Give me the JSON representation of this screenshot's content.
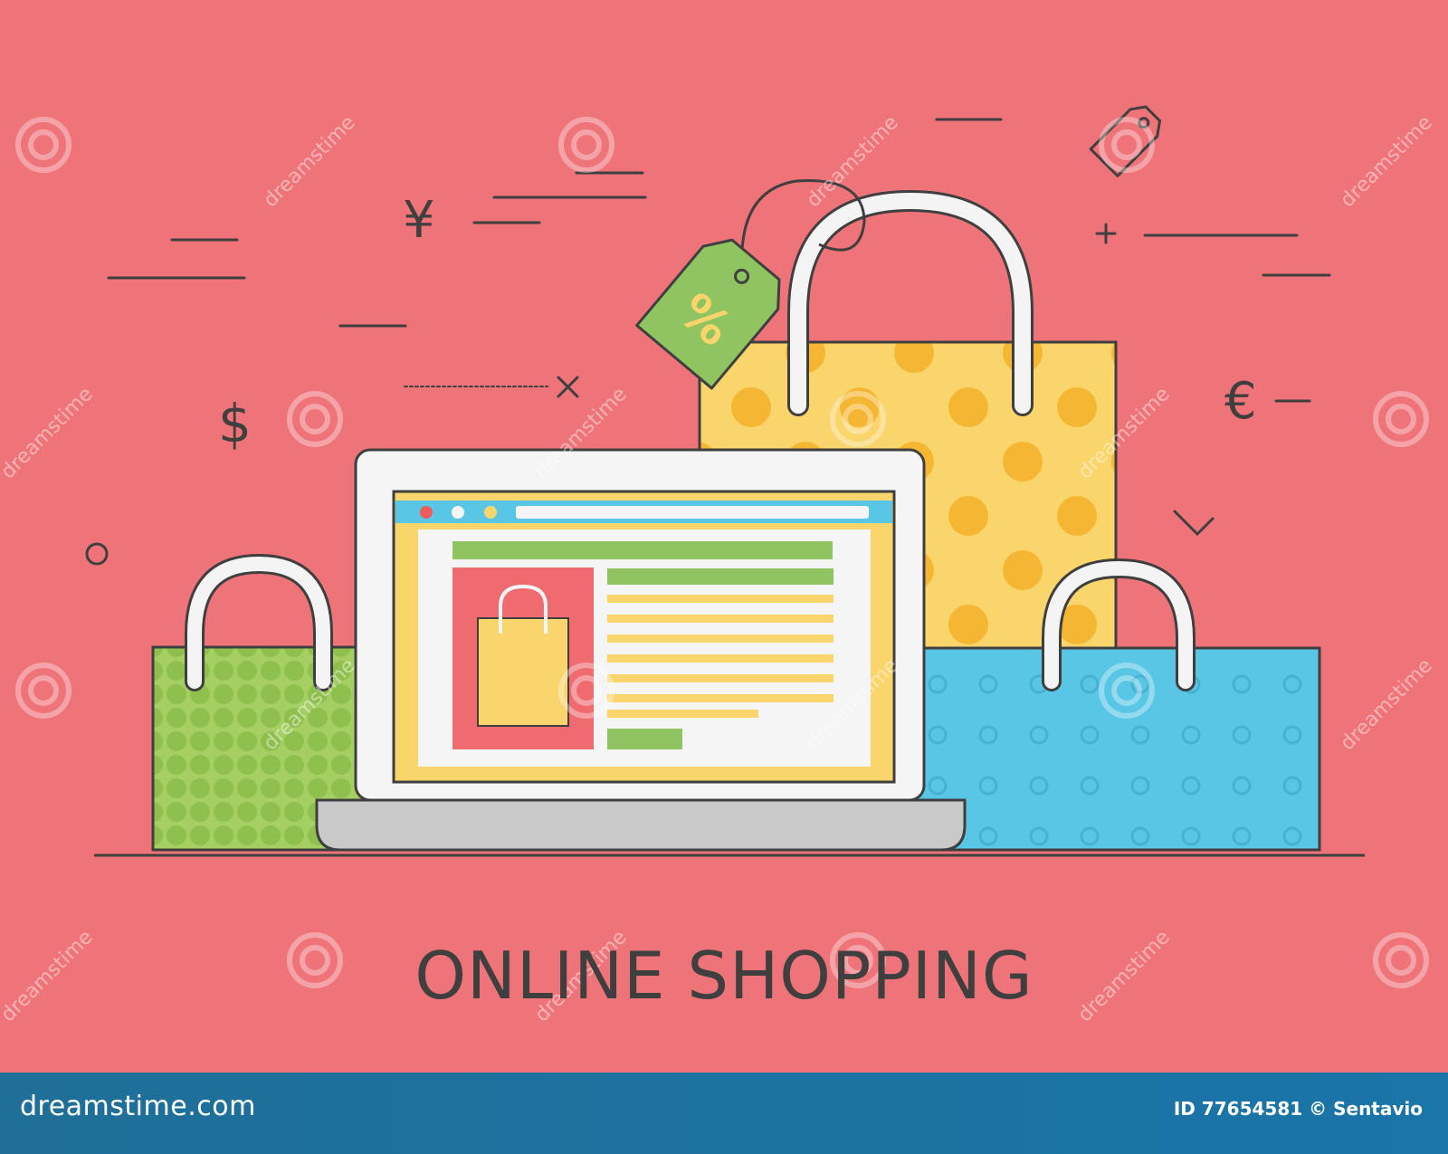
{
  "illustration": {
    "title": "ONLINE SHOPPING",
    "currency_symbols": [
      "¥",
      "$",
      "€"
    ],
    "tag_label": "%"
  },
  "watermark": {
    "text": "dreamstime"
  },
  "footer": {
    "site": "dreamstime.com",
    "image_id": "ID 77654581",
    "author": "© Sentavio"
  },
  "colors": {
    "background": "#ef7479",
    "green_bag": "#a6cf63",
    "yellow_bag": "#f9d56b",
    "blue_bag": "#5ac6e6",
    "footer": "#1a75a8",
    "outline": "#3f3f3f"
  }
}
